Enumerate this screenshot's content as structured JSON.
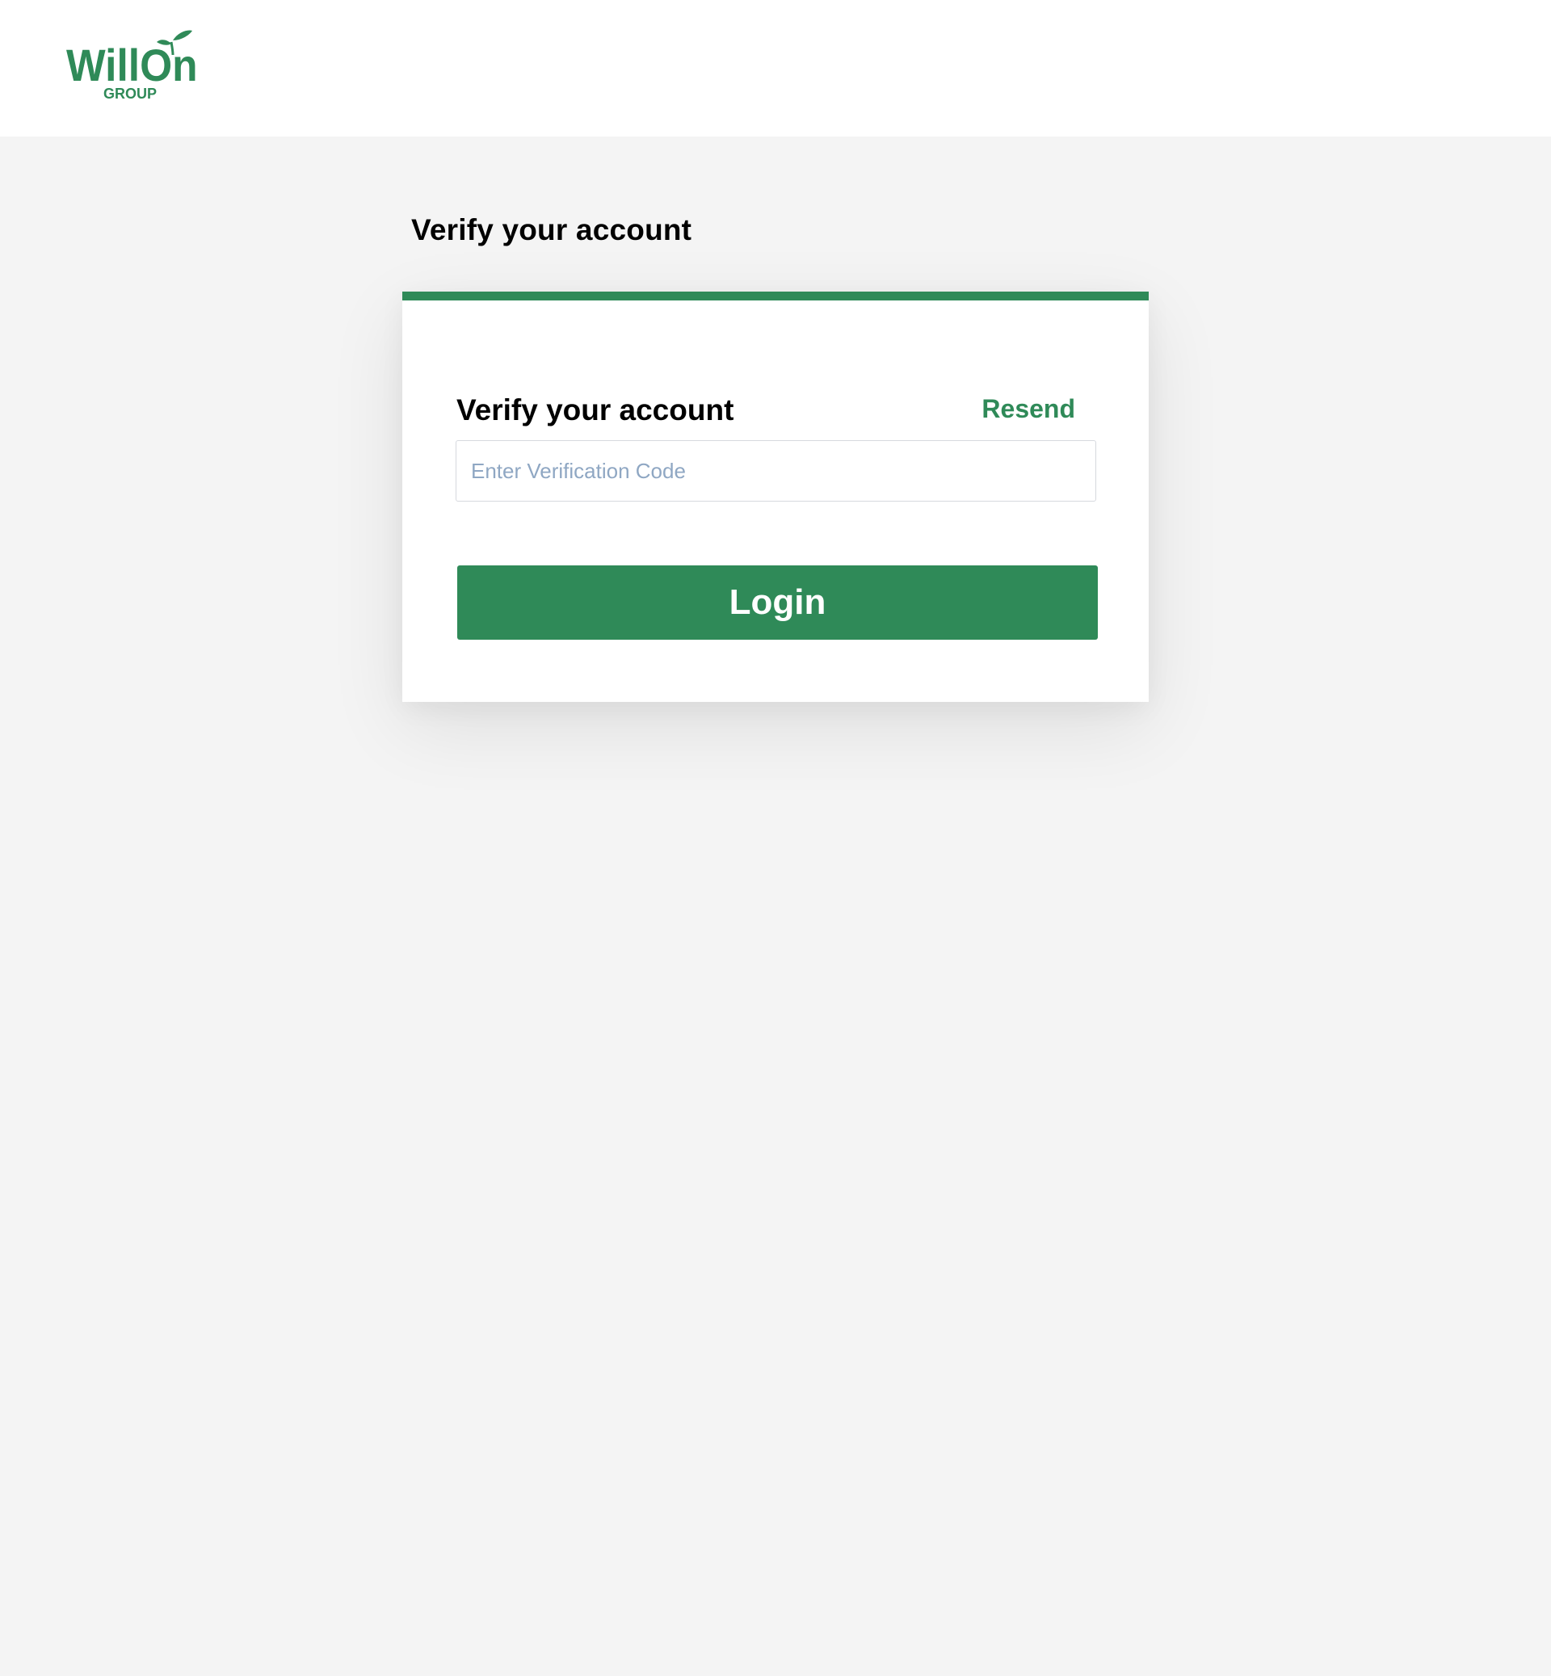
{
  "brand": {
    "logo_text": "WillOn",
    "logo_subtext": "GROUP",
    "color": "#2f8a58"
  },
  "page": {
    "heading": "Verify your account"
  },
  "card": {
    "title": "Verify your account",
    "resend_label": "Resend",
    "code_placeholder": "Enter Verification Code",
    "code_value": "",
    "login_label": "Login"
  },
  "colors": {
    "accent": "#2f8a58",
    "background": "#f4f4f4",
    "placeholder": "#8fa7c3"
  }
}
